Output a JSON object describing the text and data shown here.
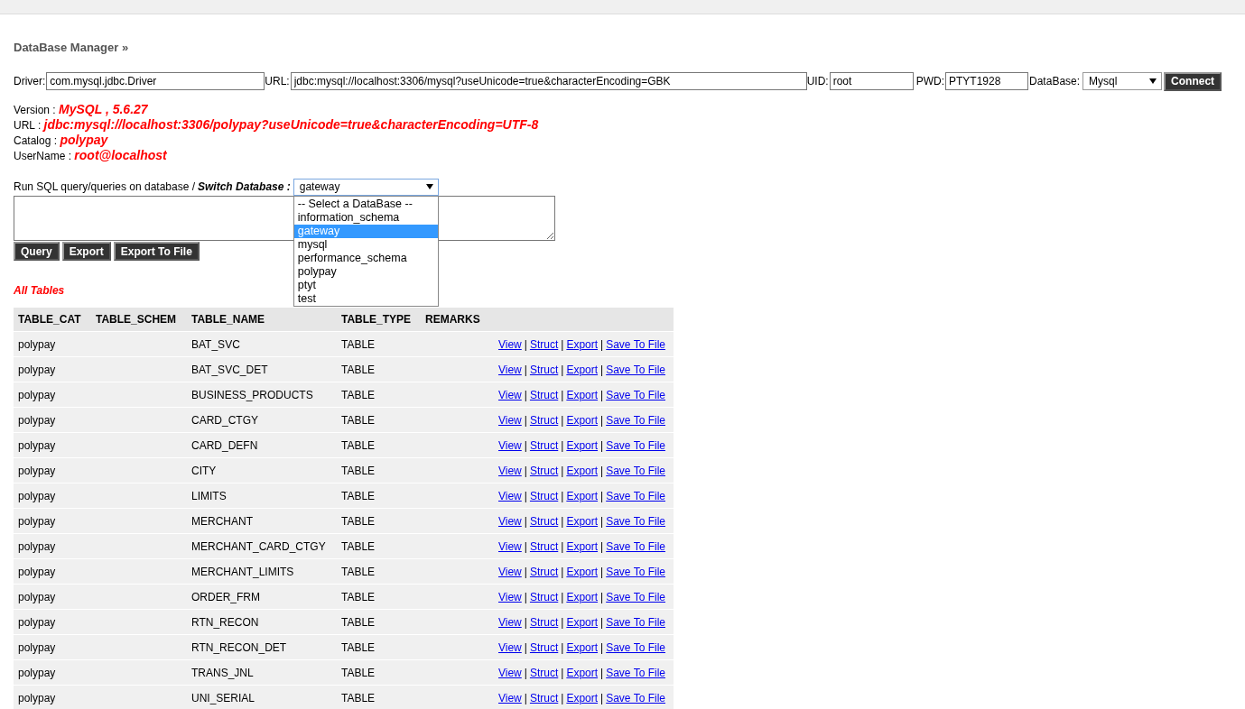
{
  "title": "DataBase Manager »",
  "connection": {
    "driver_label": "Driver:",
    "driver": "com.mysql.jdbc.Driver",
    "url_label": "URL:",
    "url": "jdbc:mysql://localhost:3306/mysql?useUnicode=true&characterEncoding=GBK",
    "uid_label": "UID:",
    "uid": "root",
    "pwd_label": "PWD:",
    "pwd": "PTYT1928",
    "db_label": "DataBase:",
    "db": "Mysql",
    "button": "Connect"
  },
  "info": [
    {
      "label": "Version : ",
      "value": "MySQL , 5.6.27"
    },
    {
      "label": "URL : ",
      "value": "jdbc:mysql://localhost:3306/polypay?useUnicode=true&characterEncoding=UTF-8"
    },
    {
      "label": "Catalog : ",
      "value": "polypay"
    },
    {
      "label": "UserName : ",
      "value": "root@localhost"
    }
  ],
  "query": {
    "label": "Run SQL query/queries on database / ",
    "switch_label": "Switch Database :",
    "selected_db": "gateway",
    "expanded": true,
    "options": [
      {
        "label": "-- Select a DataBase --",
        "selected": false
      },
      {
        "label": "information_schema",
        "selected": false
      },
      {
        "label": "gateway",
        "selected": true
      },
      {
        "label": "mysql",
        "selected": false
      },
      {
        "label": "performance_schema",
        "selected": false
      },
      {
        "label": "polypay",
        "selected": false
      },
      {
        "label": "ptyt",
        "selected": false
      },
      {
        "label": "test",
        "selected": false
      }
    ],
    "buttons": [
      "Query",
      "Export",
      "Export To File"
    ]
  },
  "tables_heading": "All Tables",
  "table": {
    "columns": [
      "TABLE_CAT",
      "TABLE_SCHEM",
      "TABLE_NAME",
      "TABLE_TYPE",
      "REMARKS"
    ],
    "rows": [
      {
        "cat": "polypay",
        "name": "BAT_SVC",
        "type": "TABLE",
        "actions": [
          "View",
          "|",
          "Struct",
          "|",
          "Export",
          "|",
          "Save To File"
        ]
      },
      {
        "cat": "polypay",
        "name": "BAT_SVC_DET",
        "type": "TABLE",
        "actions": [
          "View",
          "|",
          "Struct",
          "|",
          "Export",
          "|",
          "Save To File"
        ]
      },
      {
        "cat": "polypay",
        "name": "BUSINESS_PRODUCTS",
        "type": "TABLE",
        "actions": [
          "View",
          "|",
          "Struct",
          "|",
          "Export",
          "|",
          "Save To File"
        ]
      },
      {
        "cat": "polypay",
        "name": "CARD_CTGY",
        "type": "TABLE",
        "actions": [
          "View",
          "|",
          "Struct",
          "|",
          "Export",
          "|",
          "Save To File"
        ]
      },
      {
        "cat": "polypay",
        "name": "CARD_DEFN",
        "type": "TABLE",
        "actions": [
          "View",
          "|",
          "Struct",
          "|",
          "Export",
          "|",
          "Save To File"
        ]
      },
      {
        "cat": "polypay",
        "name": "CITY",
        "type": "TABLE",
        "actions": [
          "View",
          "|",
          "Struct",
          "|",
          "Export",
          "|",
          "Save To File"
        ]
      },
      {
        "cat": "polypay",
        "name": "LIMITS",
        "type": "TABLE",
        "actions": [
          "View",
          "|",
          "Struct",
          "|",
          "Export",
          "|",
          "Save To File"
        ]
      },
      {
        "cat": "polypay",
        "name": "MERCHANT",
        "type": "TABLE",
        "actions": [
          "View",
          "|",
          "Struct",
          "|",
          "Export",
          "|",
          "Save To File"
        ]
      },
      {
        "cat": "polypay",
        "name": "MERCHANT_CARD_CTGY",
        "type": "TABLE",
        "actions": [
          "View",
          "|",
          "Struct",
          "|",
          "Export",
          "|",
          "Save To File"
        ]
      },
      {
        "cat": "polypay",
        "name": "MERCHANT_LIMITS",
        "type": "TABLE",
        "actions": [
          "View",
          "|",
          "Struct",
          "|",
          "Export",
          "|",
          "Save To File"
        ]
      },
      {
        "cat": "polypay",
        "name": "ORDER_FRM",
        "type": "TABLE",
        "actions": [
          "View",
          "|",
          "Struct",
          "|",
          "Export",
          "|",
          "Save To File"
        ]
      },
      {
        "cat": "polypay",
        "name": "RTN_RECON",
        "type": "TABLE",
        "actions": [
          "View",
          "|",
          "Struct",
          "|",
          "Export",
          "|",
          "Save To File"
        ]
      },
      {
        "cat": "polypay",
        "name": "RTN_RECON_DET",
        "type": "TABLE",
        "actions": [
          "View",
          "|",
          "Struct",
          "|",
          "Export",
          "|",
          "Save To File"
        ]
      },
      {
        "cat": "polypay",
        "name": "TRANS_JNL",
        "type": "TABLE",
        "actions": [
          "View",
          "|",
          "Struct",
          "|",
          "Export",
          "|",
          "Save To File"
        ]
      },
      {
        "cat": "polypay",
        "name": "UNI_SERIAL",
        "type": "TABLE",
        "actions": [
          "View",
          "|",
          "Struct",
          "|",
          "Export",
          "|",
          "Save To File"
        ]
      }
    ]
  }
}
